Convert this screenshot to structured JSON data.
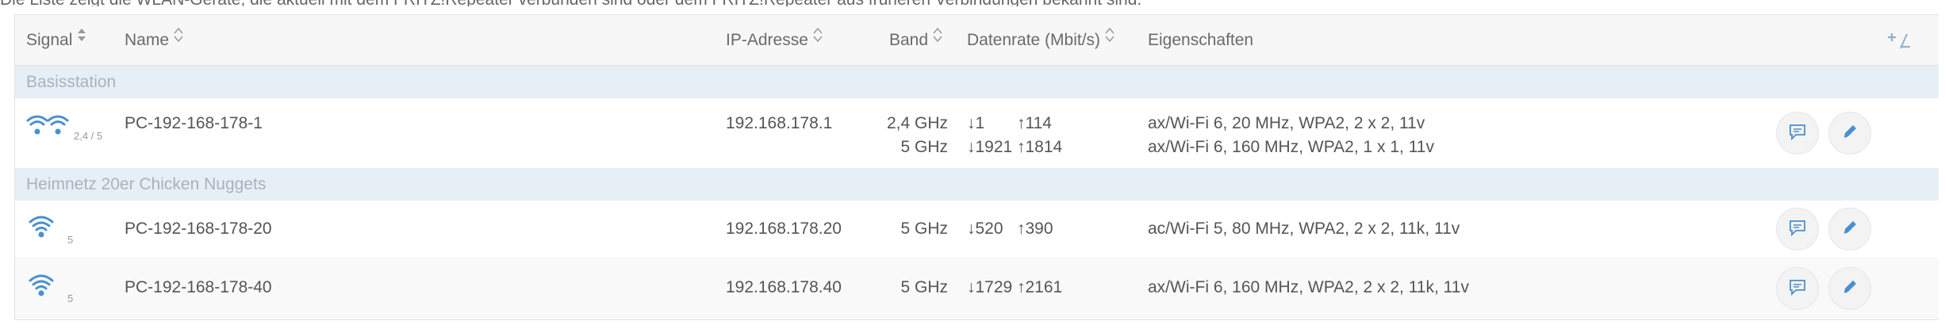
{
  "intro_text": "Die Liste zeigt die WLAN-Geräte, die aktuell mit dem FRITZ!Repeater verbunden sind oder dem FRITZ!Repeater aus früheren Verbindungen bekannt sind.",
  "columns": {
    "signal": "Signal",
    "name": "Name",
    "ip": "IP-Adresse",
    "band": "Band",
    "rate": "Datenrate (Mbit/s)",
    "props": "Eigenschaften"
  },
  "groups": [
    {
      "label": "Basisstation",
      "rows": [
        {
          "signal_label": "2,4 / 5",
          "name": "PC-192-168-178-1",
          "ip": "192.168.178.1",
          "bands": [
            "2,4 GHz",
            "5 GHz"
          ],
          "rates": [
            {
              "down": "↓1",
              "up": "↑114"
            },
            {
              "down": "↓1921",
              "up": "↑1814"
            }
          ],
          "props": [
            "ax/Wi-Fi 6, 20 MHz, WPA2, 2 x 2, 11v",
            "ax/Wi-Fi 6, 160 MHz, WPA2, 1 x 1, 11v"
          ]
        }
      ]
    },
    {
      "label": "Heimnetz 20er Chicken Nuggets",
      "rows": [
        {
          "signal_label": "5",
          "name": "PC-192-168-178-20",
          "ip": "192.168.178.20",
          "bands": [
            "5 GHz"
          ],
          "rates": [
            {
              "down": "↓520",
              "up": "↑390"
            }
          ],
          "props": [
            "ac/Wi-Fi 5, 80 MHz, WPA2, 2 x 2, 11k, 11v"
          ]
        },
        {
          "signal_label": "5",
          "name": "PC-192-168-178-40",
          "ip": "192.168.178.40",
          "bands": [
            "5 GHz"
          ],
          "rates": [
            {
              "down": "↓1729",
              "up": "↑2161"
            }
          ],
          "props": [
            "ax/Wi-Fi 6, 160 MHz, WPA2, 2 x 2, 11k, 11v"
          ]
        }
      ]
    }
  ],
  "icons": {
    "wifi": "wifi-signal-icon",
    "sort": "sort-icon",
    "details": "chat-bubble-icon",
    "edit": "pencil-icon",
    "columns": "column-toggle-icon"
  },
  "colors": {
    "wifi": "#4a8fd0",
    "edit": "#4a8fd0",
    "group_bg": "#e6eef6"
  }
}
